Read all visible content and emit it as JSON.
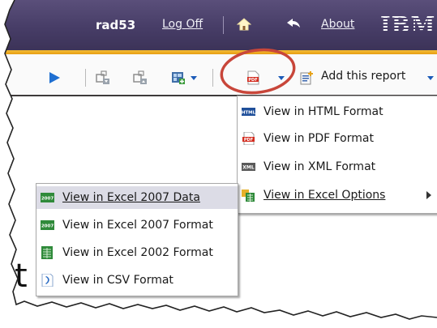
{
  "header": {
    "username": "rad53",
    "logoff_label": "Log Off",
    "about_label": "About",
    "brand_logo": "IBM",
    "icons": [
      "home-icon",
      "back-arrow-icon"
    ]
  },
  "toolbar": {
    "icons": [
      "run-icon",
      "move-down-icon",
      "move-up-icon",
      "chart-edit-icon",
      "pdf-format-icon",
      "add-report-icon"
    ],
    "add_report_label": "Add this report"
  },
  "format_menu": {
    "items": [
      {
        "label": "View in HTML Format",
        "icon": "html-icon"
      },
      {
        "label": "View in PDF Format",
        "icon": "pdf-icon"
      },
      {
        "label": "View in XML Format",
        "icon": "xml-icon"
      },
      {
        "label": "View in Excel Options",
        "icon": "excel-options-icon",
        "has_submenu": true
      }
    ]
  },
  "excel_submenu": {
    "items": [
      {
        "label": "View in Excel 2007 Data",
        "icon": "excel-2007-icon",
        "highlighted": true
      },
      {
        "label": "View in Excel 2007 Format",
        "icon": "excel-2007-icon"
      },
      {
        "label": "View in Excel 2002 Format",
        "icon": "excel-2002-icon"
      },
      {
        "label": "View in CSV Format",
        "icon": "csv-icon"
      }
    ]
  },
  "background_text": "t",
  "colors": {
    "header_bg": "#473d67",
    "accent_bar": "#f0a820",
    "annotation_circle": "#c8463a",
    "highlight": "#dcdce6"
  }
}
